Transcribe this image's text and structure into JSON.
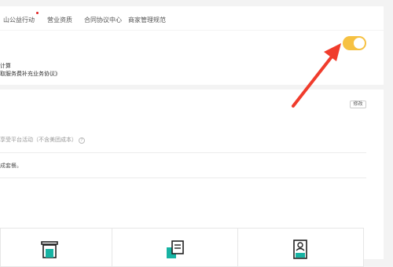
{
  "tabs": [
    {
      "label": "山公益行动",
      "dot": true
    },
    {
      "label": "营业资质"
    },
    {
      "label": "合同协议中心"
    },
    {
      "label": "商家管理规范"
    }
  ],
  "service_card": {
    "line1": "计算",
    "line2": "取服务费补充业务协议》",
    "toggle_on": true
  },
  "platform_card": {
    "edit_label": "修改",
    "line1": "享受平台活动（不含美团成本）",
    "help_glyph": "?",
    "line2": "成套餐。"
  },
  "colors": {
    "toggle": "#f6c142",
    "arrow": "#f03c2c",
    "icon_teal": "#17b3a3"
  },
  "icons": [
    "trash-bin-icon",
    "document-copy-icon",
    "shop-card-icon"
  ]
}
